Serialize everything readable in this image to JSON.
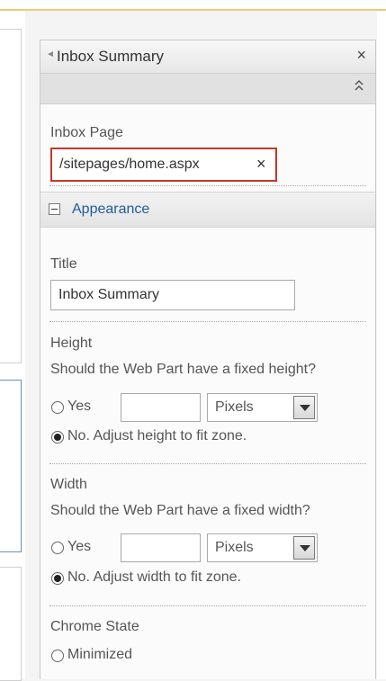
{
  "panel": {
    "title": "Inbox Summary",
    "close_glyph": "×",
    "collapse_glyph": "⌃⌃"
  },
  "inbox_page": {
    "label": "Inbox Page",
    "value": "/sitepages/home.aspx",
    "clear_glyph": "×"
  },
  "appearance": {
    "section_title": "Appearance",
    "title_label": "Title",
    "title_value": "Inbox Summary",
    "height": {
      "label": "Height",
      "question": "Should the Web Part have a fixed height?",
      "yes_label": "Yes",
      "unit": "Pixels",
      "no_label": "No. Adjust height to fit zone."
    },
    "width": {
      "label": "Width",
      "question": "Should the Web Part have a fixed width?",
      "yes_label": "Yes",
      "unit": "Pixels",
      "no_label": "No. Adjust width to fit zone."
    },
    "chrome_state": {
      "label": "Chrome State",
      "minimized_label": "Minimized"
    }
  }
}
